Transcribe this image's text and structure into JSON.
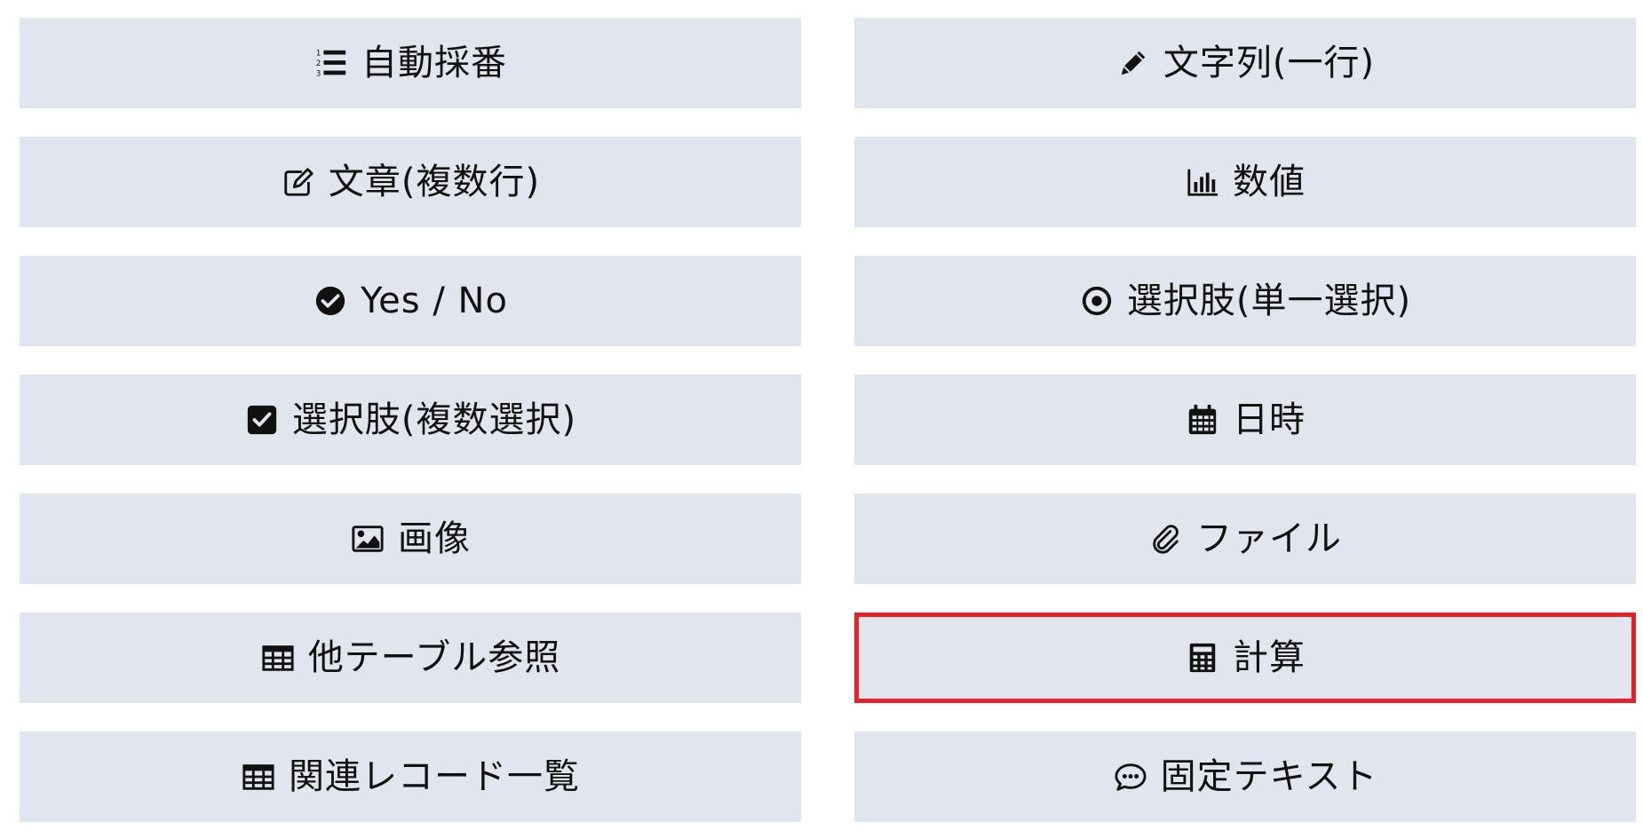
{
  "field_types": [
    {
      "id": "auto-number",
      "label": "自動採番",
      "icon": "list-ol-icon"
    },
    {
      "id": "text-single",
      "label": "文字列(一行)",
      "icon": "pencil-icon"
    },
    {
      "id": "text-multi",
      "label": "文章(複数行)",
      "icon": "edit-square-icon"
    },
    {
      "id": "number",
      "label": "数値",
      "icon": "bar-chart-icon"
    },
    {
      "id": "yes-no",
      "label": "Yes / No",
      "icon": "check-circle-icon"
    },
    {
      "id": "select-single",
      "label": "選択肢(単一選択)",
      "icon": "dot-circle-icon"
    },
    {
      "id": "select-multi",
      "label": "選択肢(複数選択)",
      "icon": "check-square-icon"
    },
    {
      "id": "datetime",
      "label": "日時",
      "icon": "calendar-icon"
    },
    {
      "id": "image",
      "label": "画像",
      "icon": "image-icon"
    },
    {
      "id": "file",
      "label": "ファイル",
      "icon": "paperclip-icon"
    },
    {
      "id": "table-ref",
      "label": "他テーブル参照",
      "icon": "table-icon"
    },
    {
      "id": "calculation",
      "label": "計算",
      "icon": "calculator-icon"
    },
    {
      "id": "related-records",
      "label": "関連レコード一覧",
      "icon": "table-icon"
    },
    {
      "id": "fixed-text",
      "label": "固定テキスト",
      "icon": "comment-dots-icon"
    }
  ],
  "selected": "calculation",
  "colors": {
    "button_bg": "#e1e5ee",
    "text": "#111111",
    "highlight_border": "#e3212b"
  }
}
